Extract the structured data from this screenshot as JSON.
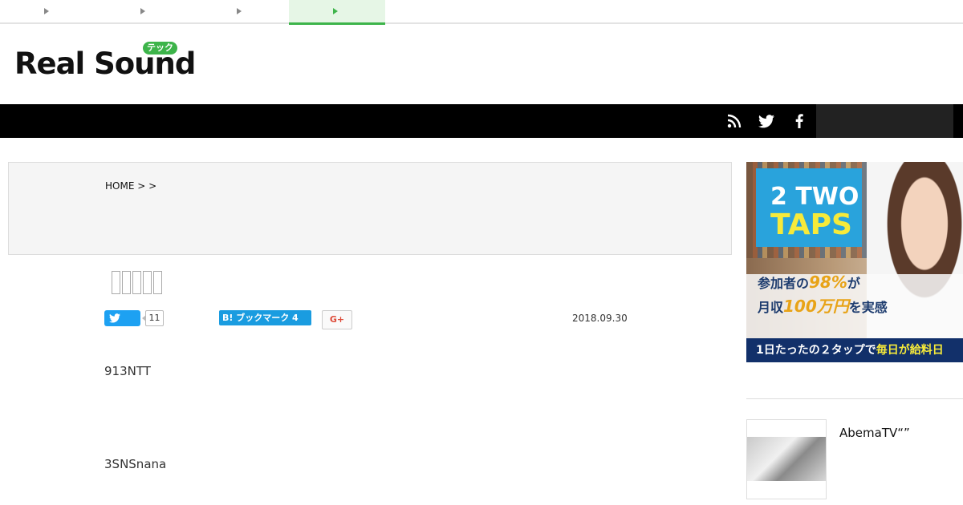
{
  "top_tabs": [
    {
      "label": "",
      "active": false
    },
    {
      "label": "",
      "active": false
    },
    {
      "label": "",
      "active": false
    },
    {
      "label": "",
      "active": true
    }
  ],
  "logo": {
    "text": "Real Sound",
    "badge": "テック"
  },
  "nav": {
    "icons": [
      "rss-icon",
      "twitter-icon",
      "facebook-icon"
    ]
  },
  "breadcrumb": {
    "text": "HOME >  >"
  },
  "share": {
    "tweet_count": "11",
    "hatena_label": "B! ブックマーク 4",
    "gplus_label": "G+",
    "date": "2018.09.30"
  },
  "article": {
    "para1": "913NTT",
    "para2": "3SNSnana"
  },
  "ad": {
    "logo_two": "2 TWO",
    "logo_taps": "TAPS",
    "line1_a": "参加者の",
    "line1_hl": "98%",
    "line1_b": "が",
    "line2_a": "月収",
    "line2_hl": "100万円",
    "line2_b": "を実感",
    "banner_a": "1日たったの２タップで",
    "banner_b": "毎日が給料日"
  },
  "sidebar": {
    "item_title": "AbemaTV“”"
  }
}
